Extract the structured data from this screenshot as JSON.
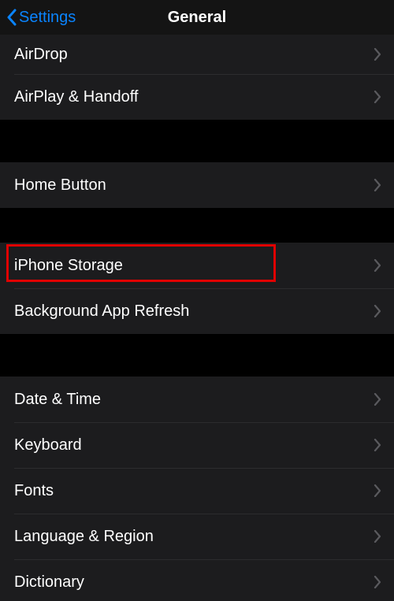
{
  "navbar": {
    "back_label": "Settings",
    "title": "General"
  },
  "groups": [
    {
      "items": [
        {
          "label": "AirDrop"
        },
        {
          "label": "AirPlay & Handoff"
        }
      ]
    },
    {
      "items": [
        {
          "label": "Home Button"
        }
      ]
    },
    {
      "items": [
        {
          "label": "iPhone Storage"
        },
        {
          "label": "Background App Refresh"
        }
      ]
    },
    {
      "items": [
        {
          "label": "Date & Time"
        },
        {
          "label": "Keyboard"
        },
        {
          "label": "Fonts"
        },
        {
          "label": "Language & Region"
        },
        {
          "label": "Dictionary"
        }
      ]
    }
  ],
  "highlight": {
    "target_label": "iPhone Storage"
  }
}
